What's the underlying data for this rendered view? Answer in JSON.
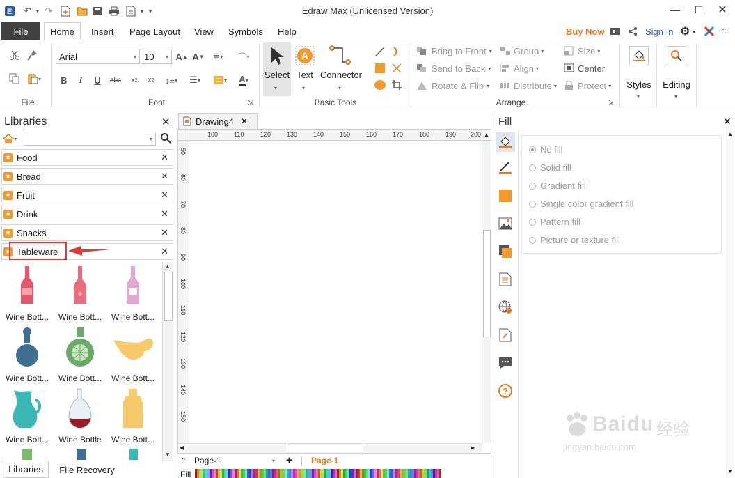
{
  "app": {
    "title": "Edraw Max (Unlicensed Version)"
  },
  "menu": {
    "file": "File",
    "tabs": [
      "Home",
      "Insert",
      "Page Layout",
      "View",
      "Symbols",
      "Help"
    ],
    "buy_now": "Buy Now",
    "sign_in": "Sign In"
  },
  "ribbon": {
    "file_group": "File",
    "font": {
      "family": "Arial",
      "size": "10",
      "group_label": "Font"
    },
    "basic_tools": {
      "select": "Select",
      "text": "Text",
      "connector": "Connector",
      "group_label": "Basic Tools"
    },
    "arrange": {
      "bring_to_front": "Bring to Front",
      "send_to_back": "Send to Back",
      "rotate_flip": "Rotate & Flip",
      "group": "Group",
      "align": "Align",
      "distribute": "Distribute",
      "size": "Size",
      "center": "Center",
      "protect": "Protect",
      "group_label": "Arrange"
    },
    "styles": "Styles",
    "editing": "Editing"
  },
  "libraries": {
    "title": "Libraries",
    "search_value": "",
    "items": [
      "Food",
      "Bread",
      "Fruit",
      "Drink",
      "Snacks",
      "Tableware"
    ],
    "shapes": [
      "Wine Bott...",
      "Wine Bott...",
      "Wine Bott...",
      "Wine Bott...",
      "Wine Bott...",
      "Wine Bott...",
      "Wine Bott...",
      "Wine Bottle",
      "Wine Bott..."
    ],
    "bottom_tabs": [
      "Libraries",
      "File Recovery"
    ]
  },
  "document": {
    "tab": "Drawing4",
    "hruler": [
      "100",
      "110",
      "120",
      "130",
      "140",
      "150",
      "160",
      "170",
      "180",
      "190",
      "200"
    ],
    "vruler": [
      "50",
      "60",
      "70",
      "80",
      "90",
      "100",
      "110",
      "120",
      "130",
      "140",
      "150"
    ],
    "page_selector": "Page-1",
    "active_page": "Page-1",
    "fill_label": "Fill"
  },
  "fill_panel": {
    "title": "Fill",
    "options": [
      "No fill",
      "Solid fill",
      "Gradient fill",
      "Single color gradient fill",
      "Pattern fill",
      "Picture or texture fill"
    ],
    "selected": "No fill"
  },
  "watermark": {
    "brand": "Baidu",
    "brand_cn": "经验",
    "url": "jingyan.baidu.com"
  },
  "colors": {
    "accent": "#e87c20",
    "dark_tab": "#404040",
    "highlight": "#e53935",
    "brand_blue": "#2a5db0"
  }
}
